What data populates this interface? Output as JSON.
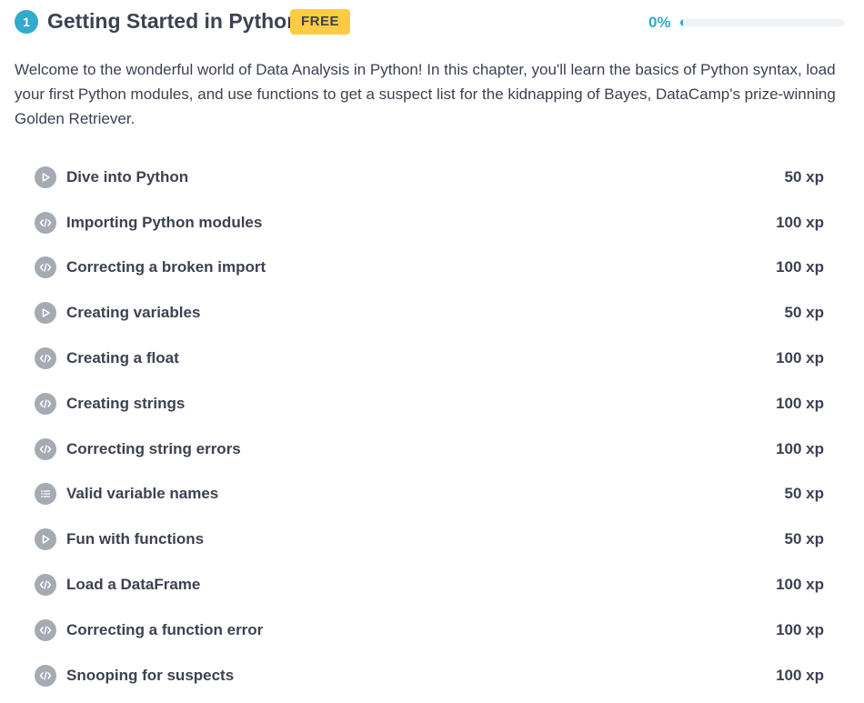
{
  "chapter": {
    "number": "1",
    "title": "Getting Started in Python",
    "badge": "FREE",
    "progress_label": "0%",
    "progress_fraction": 0,
    "description": "Welcome to the wonderful world of Data Analysis in Python! In this chapter, you'll learn the basics of Python syntax, load your first Python modules, and use functions to get a suspect list for the kidnapping of Bayes, DataCamp's prize-winning Golden Retriever."
  },
  "colors": {
    "accent": "#33aacc",
    "badge": "#fdcb44",
    "icon_bg": "#a6aab2",
    "text": "#3d4251"
  },
  "exercises": [
    {
      "type": "video",
      "icon": "play-icon",
      "title": "Dive into Python",
      "xp": "50 xp"
    },
    {
      "type": "code",
      "icon": "code-icon",
      "title": "Importing Python modules",
      "xp": "100 xp"
    },
    {
      "type": "code",
      "icon": "code-icon",
      "title": "Correcting a broken import",
      "xp": "100 xp"
    },
    {
      "type": "video",
      "icon": "play-icon",
      "title": "Creating variables",
      "xp": "50 xp"
    },
    {
      "type": "code",
      "icon": "code-icon",
      "title": "Creating a float",
      "xp": "100 xp"
    },
    {
      "type": "code",
      "icon": "code-icon",
      "title": "Creating strings",
      "xp": "100 xp"
    },
    {
      "type": "code",
      "icon": "code-icon",
      "title": "Correcting string errors",
      "xp": "100 xp"
    },
    {
      "type": "multiple-choice",
      "icon": "list-icon",
      "title": "Valid variable names",
      "xp": "50 xp"
    },
    {
      "type": "video",
      "icon": "play-icon",
      "title": "Fun with functions",
      "xp": "50 xp"
    },
    {
      "type": "code",
      "icon": "code-icon",
      "title": "Load a DataFrame",
      "xp": "100 xp"
    },
    {
      "type": "code",
      "icon": "code-icon",
      "title": "Correcting a function error",
      "xp": "100 xp"
    },
    {
      "type": "code",
      "icon": "code-icon",
      "title": "Snooping for suspects",
      "xp": "100 xp"
    }
  ]
}
